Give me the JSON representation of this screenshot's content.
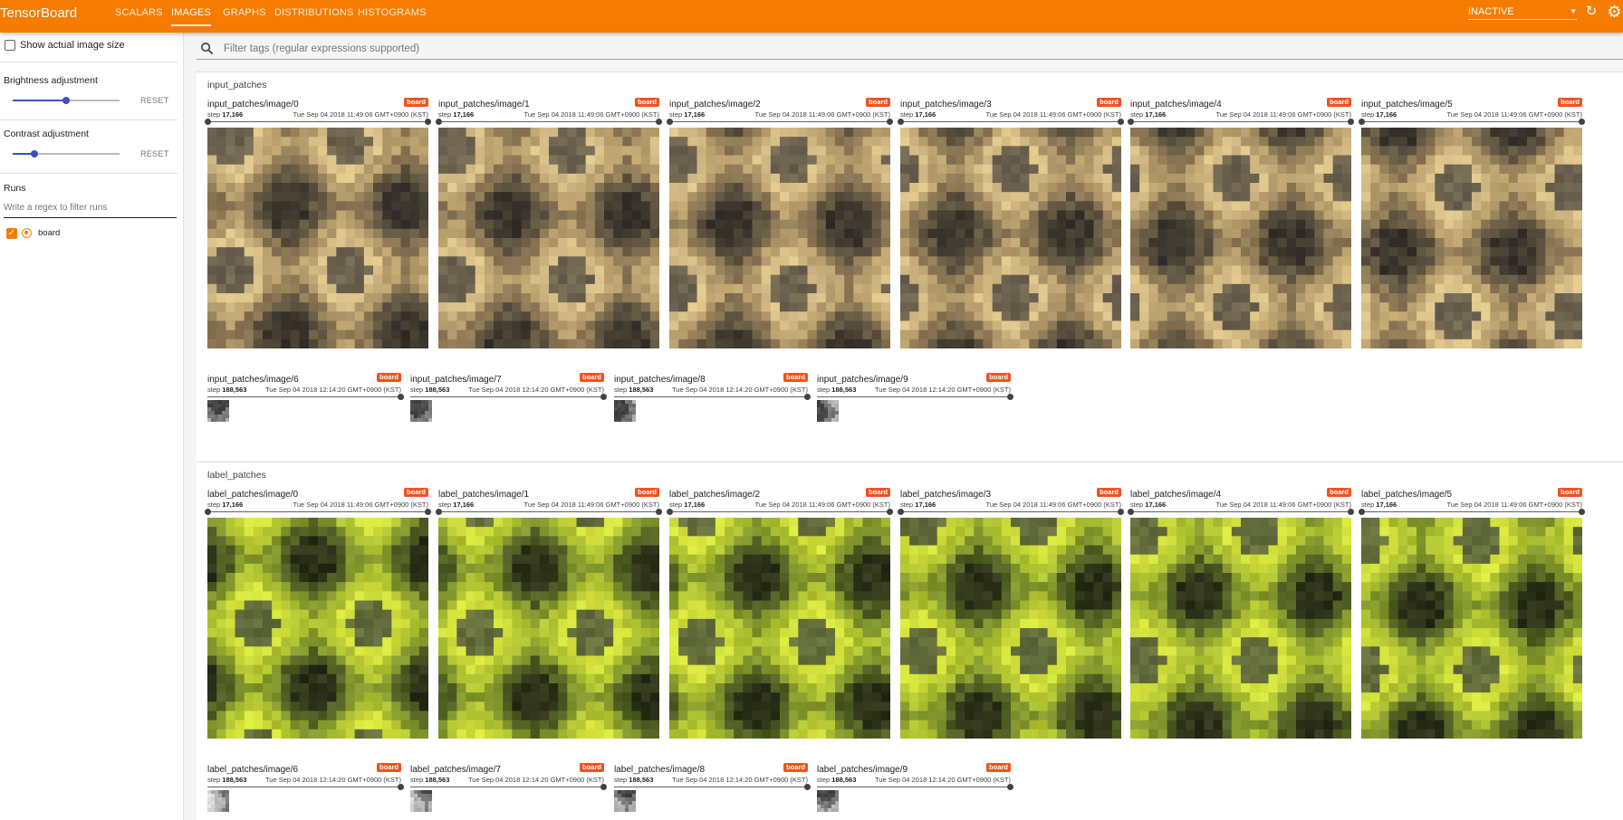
{
  "app": {
    "brand": "TensorBoard",
    "tabs": [
      "SCALARS",
      "IMAGES",
      "GRAPHS",
      "DISTRIBUTIONS",
      "HISTOGRAMS"
    ],
    "active_tab": "IMAGES",
    "status": "INACTIVE",
    "accent_color": "#f57c00"
  },
  "sidebar": {
    "show_actual_size_label": "Show actual image size",
    "show_actual_size_checked": false,
    "brightness_label": "Brightness adjustment",
    "brightness_level": 0.5,
    "contrast_label": "Contrast adjustment",
    "contrast_level": 0.2,
    "reset_label": "RESET",
    "runs_label": "Runs",
    "runs_filter_placeholder": "Write a regex to filter runs",
    "runs": [
      {
        "name": "board",
        "checked": true,
        "color": "#f57c00"
      }
    ]
  },
  "main": {
    "filter_placeholder": "Filter tags (regular expressions supported)",
    "badge": "board",
    "step_label": "step",
    "sections": [
      {
        "title": "input_patches",
        "palette": "tan",
        "cards": [
          {
            "name": "input_patches/image/0",
            "step": "17,166",
            "time": "Tue Sep 04 2018 11:49:06 GMT+0900 (KST)"
          },
          {
            "name": "input_patches/image/1",
            "step": "17,166",
            "time": "Tue Sep 04 2018 11:49:06 GMT+0900 (KST)"
          },
          {
            "name": "input_patches/image/2",
            "step": "17,166",
            "time": "Tue Sep 04 2018 11:49:06 GMT+0900 (KST)"
          },
          {
            "name": "input_patches/image/3",
            "step": "17,166",
            "time": "Tue Sep 04 2018 11:49:06 GMT+0900 (KST)"
          },
          {
            "name": "input_patches/image/4",
            "step": "17,166",
            "time": "Tue Sep 04 2018 11:49:06 GMT+0900 (KST)"
          },
          {
            "name": "input_patches/image/5",
            "step": "17,166",
            "time": "Tue Sep 04 2018 11:49:06 GMT+0900 (KST)"
          },
          {
            "name": "input_patches/image/6",
            "step": "188,563",
            "time": "Tue Sep 04 2018 12:14:20 GMT+0900 (KST)"
          },
          {
            "name": "input_patches/image/7",
            "step": "188,563",
            "time": "Tue Sep 04 2018 12:14:20 GMT+0900 (KST)"
          },
          {
            "name": "input_patches/image/8",
            "step": "188,563",
            "time": "Tue Sep 04 2018 12:14:20 GMT+0900 (KST)"
          },
          {
            "name": "input_patches/image/9",
            "step": "188,563",
            "time": "Tue Sep 04 2018 12:14:20 GMT+0900 (KST)"
          }
        ]
      },
      {
        "title": "label_patches",
        "palette": "green",
        "cards": [
          {
            "name": "label_patches/image/0",
            "step": "17,166",
            "time": "Tue Sep 04 2018 11:49:06 GMT+0900 (KST)"
          },
          {
            "name": "label_patches/image/1",
            "step": "17,166",
            "time": "Tue Sep 04 2018 11:49:06 GMT+0900 (KST)"
          },
          {
            "name": "label_patches/image/2",
            "step": "17,166",
            "time": "Tue Sep 04 2018 11:49:06 GMT+0900 (KST)"
          },
          {
            "name": "label_patches/image/3",
            "step": "17,166",
            "time": "Tue Sep 04 2018 11:49:06 GMT+0900 (KST)"
          },
          {
            "name": "label_patches/image/4",
            "step": "17,166",
            "time": "Tue Sep 04 2018 11:49:06 GMT+0900 (KST)"
          },
          {
            "name": "label_patches/image/5",
            "step": "17,166",
            "time": "Tue Sep 04 2018 11:49:06 GMT+0900 (KST)"
          },
          {
            "name": "label_patches/image/6",
            "step": "188,563",
            "time": "Tue Sep 04 2018 12:14:20 GMT+0900 (KST)"
          },
          {
            "name": "label_patches/image/7",
            "step": "188,563",
            "time": "Tue Sep 04 2018 12:14:20 GMT+0900 (KST)"
          },
          {
            "name": "label_patches/image/8",
            "step": "188,563",
            "time": "Tue Sep 04 2018 12:14:20 GMT+0900 (KST)"
          },
          {
            "name": "label_patches/image/9",
            "step": "188,563",
            "time": "Tue Sep 04 2018 12:14:20 GMT+0900 (KST)"
          }
        ]
      }
    ]
  }
}
